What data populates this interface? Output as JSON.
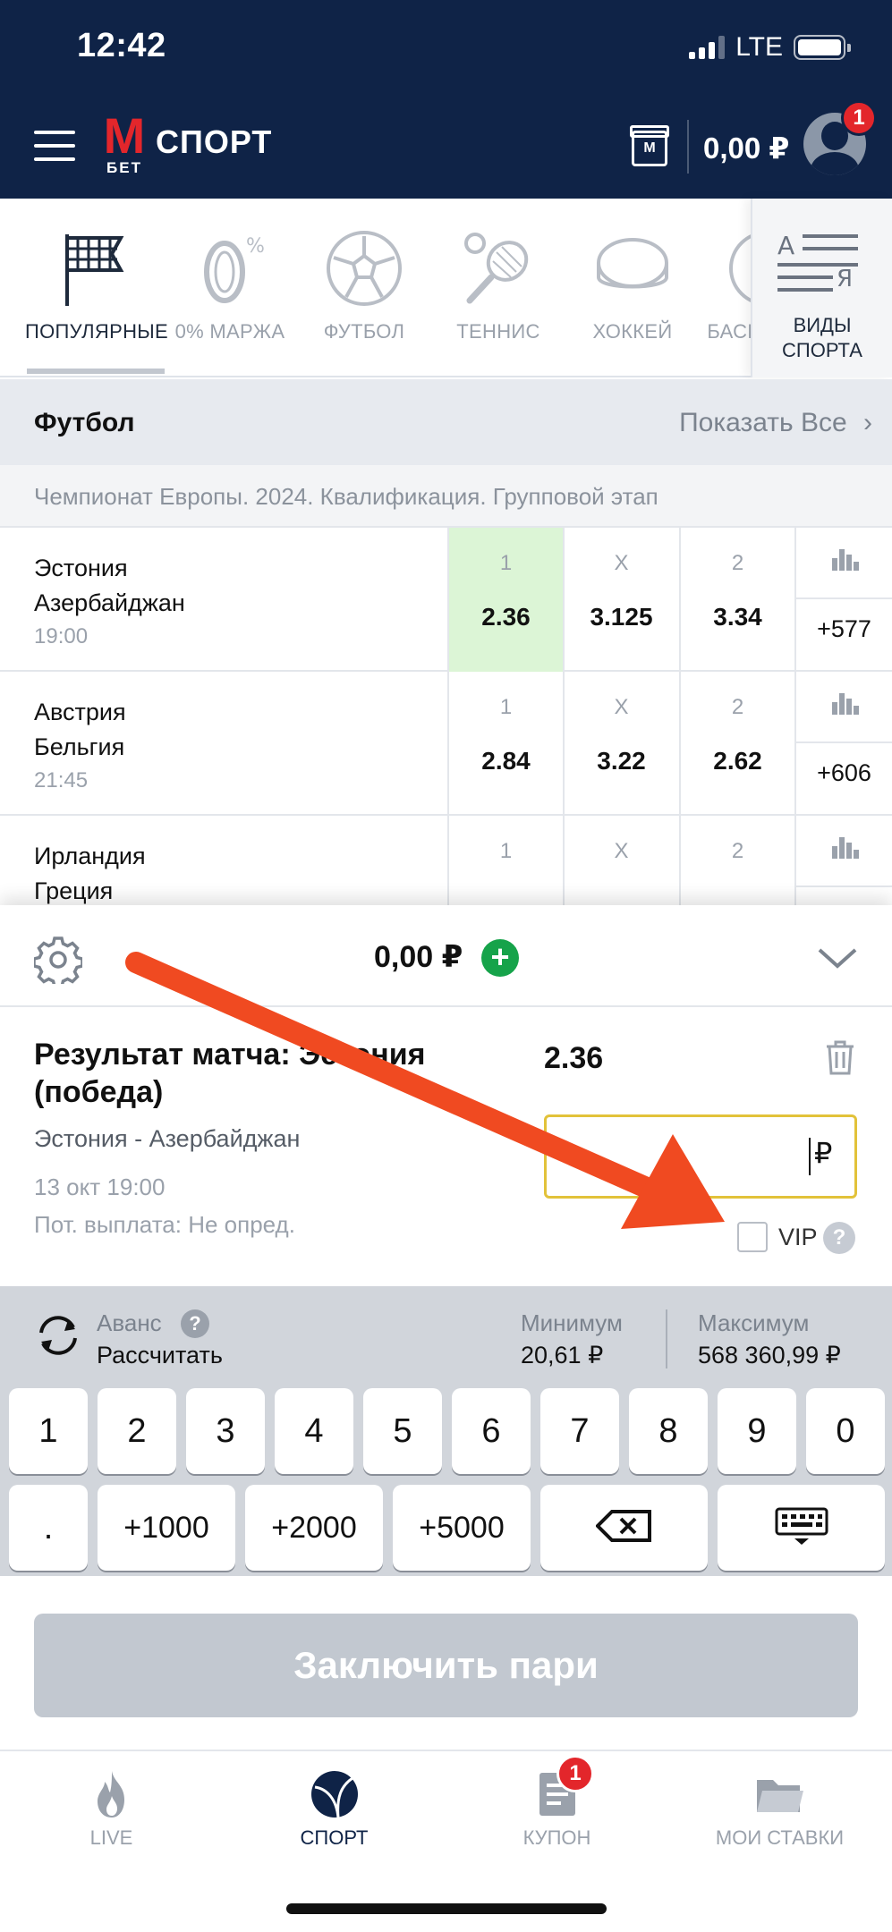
{
  "status_bar": {
    "time": "12:42",
    "network": "LTE"
  },
  "header": {
    "logo_letter": "M",
    "logo_sub": "БЕТ",
    "logo_text": "СПОРТ",
    "gift_letter": "M",
    "balance": "0,00 ₽",
    "notification_count": "1"
  },
  "categories": [
    {
      "label": "ПОПУЛЯРНЫЕ",
      "icon": "flag-icon",
      "active": true
    },
    {
      "label": "0% МАРЖА",
      "icon": "zero-percent-icon",
      "active": false
    },
    {
      "label": "ФУТБОЛ",
      "icon": "soccer-ball-icon",
      "active": false
    },
    {
      "label": "ТЕННИС",
      "icon": "tennis-racket-icon",
      "active": false
    },
    {
      "label": "ХОККЕЙ",
      "icon": "hockey-puck-icon",
      "active": false
    },
    {
      "label": "БАСКЕТБОЛ",
      "icon": "basketball-icon",
      "active": false
    }
  ],
  "all_sports": {
    "label_line1": "ВИДЫ",
    "label_line2": "СПОРТА",
    "icon_letter_a": "А",
    "icon_letter_ya": "Я"
  },
  "section": {
    "title": "Футбол",
    "show_all": "Показать Все"
  },
  "league": "Чемпионат Европы. 2024. Квалификация. Групповой этап",
  "events": [
    {
      "team1": "Эстония",
      "team2": "Азербайджан",
      "time": "19:00",
      "odds": [
        {
          "label": "1",
          "value": "2.36"
        },
        {
          "label": "X",
          "value": "3.125"
        },
        {
          "label": "2",
          "value": "3.34"
        }
      ],
      "more": "+577",
      "selected": 0
    },
    {
      "team1": "Австрия",
      "team2": "Бельгия",
      "time": "21:45",
      "odds": [
        {
          "label": "1",
          "value": "2.84"
        },
        {
          "label": "X",
          "value": "3.22"
        },
        {
          "label": "2",
          "value": "2.62"
        }
      ],
      "more": "+606",
      "selected": -1
    },
    {
      "team1": "Ирландия",
      "team2": "Греция",
      "time": "",
      "odds": [
        {
          "label": "1",
          "value": ""
        },
        {
          "label": "X",
          "value": ""
        },
        {
          "label": "2",
          "value": ""
        }
      ],
      "more": "",
      "selected": -1
    }
  ],
  "slip": {
    "total": "0,00 ₽",
    "plus": "+",
    "bet_title": "Результат матча: Эстония (победа)",
    "bet_odd": "2.36",
    "match": "Эстония - Азербайджан",
    "date": "13 окт 19:00",
    "payout": "Пот. выплата: Не опред.",
    "stake_value": "",
    "currency": "₽",
    "vip_label": "VIP",
    "help": "?"
  },
  "keypad": {
    "avans_label": "Аванс",
    "avans_action": "Рассчитать",
    "min_label": "Минимум",
    "min_value": "20,61 ₽",
    "max_label": "Максимум",
    "max_value": "568 360,99 ₽",
    "digits": [
      "1",
      "2",
      "3",
      "4",
      "5",
      "6",
      "7",
      "8",
      "9",
      "0"
    ],
    "dot": ".",
    "quick": [
      "+1000",
      "+2000",
      "+5000"
    ]
  },
  "submit_label": "Заключить пари",
  "tabs": [
    {
      "label": "LIVE",
      "icon": "fire-icon",
      "active": false
    },
    {
      "label": "СПОРТ",
      "icon": "ball-icon",
      "active": true
    },
    {
      "label": "КУПОН",
      "icon": "coupon-icon",
      "active": false
    },
    {
      "label": "МОИ СТАВКИ",
      "icon": "folder-icon",
      "active": false
    }
  ],
  "coupon_badge": "1",
  "colors": {
    "header": "#0f2347",
    "accent_red": "#e3262b",
    "plus_green": "#16a34a",
    "selected_odd": "#dcf5d6",
    "annotation_arrow": "#f04a21"
  }
}
